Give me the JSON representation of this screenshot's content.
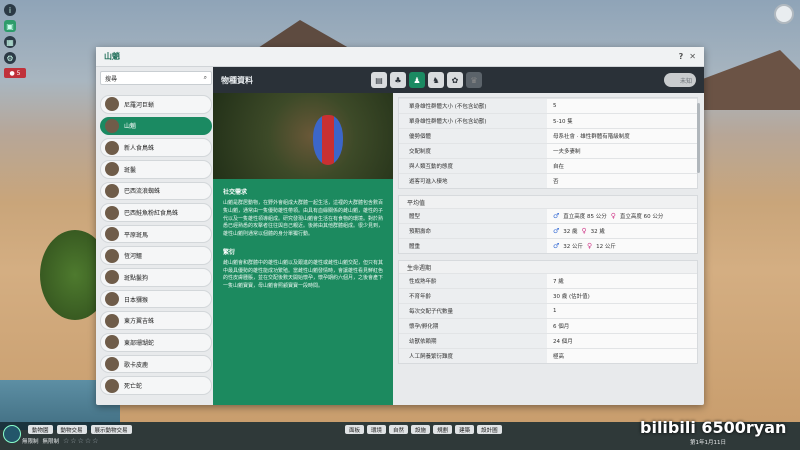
{
  "window": {
    "title": "山魈",
    "help": "?",
    "close": "✕"
  },
  "search": {
    "placeholder": "搜尋"
  },
  "list": [
    "尼羅河巨蜥",
    "山魈",
    "新人食鳥蛛",
    "斑鬣",
    "巴西流浪蜘蛛",
    "巴西鮭魚粉紅食鳥蛛",
    "平原斑馬",
    "恆河鱷",
    "斑點鬣狗",
    "日本獼猴",
    "東方翼吉蛛",
    "東部珊瑚蛇",
    "歌卡皮鹿",
    "死亡蛇"
  ],
  "panel": {
    "title": "物種資料",
    "unknown": "未知"
  },
  "description": {
    "h1": "社交需求",
    "p1": "山魈是群居動物，在野外會組成大群體一起生活，這裡的大群體包含數百隻山魈，通常由一隻優勢雄性帶領。由具有血緣關係的雌山魈，雄性的子代以及一隻雄性領導組成。研究發現山魈會生活在有食物的環境。對於熟悉已經熟悉的攻擊者往往與自己親近。後將由其他群體組成。很少見到，雄性山魈則通常以個體的身分單獨行動。",
    "h2": "繁衍",
    "p2": "雌山魈會和群體中的雄性山魈以及跟進的雄性或雌性山魈交配，但只有其中最具優勢的雄性能成功繁殖。當雌性山魈發情時，會讓雄性看見鮮紅色的性皮膚腫脹，並在交配後數天開始懷孕，懷孕期約六個月，之後會產下一隻山魈寶寶，母山魈會照顧寶寶一段時間。"
  },
  "stats": {
    "group": [
      {
        "k": "單身雄性群體大小 (不包含幼獸)",
        "v": "5"
      },
      {
        "k": "單身雄性群體大小 (不包含幼獸)",
        "v": "5-10 隻"
      },
      {
        "k": "優勢個體",
        "v": "母系社會 · 雄性群體有階級制度"
      },
      {
        "k": "交配制度",
        "v": "一夫多妻制"
      },
      {
        "k": "與人類互動的態度",
        "v": "自在"
      },
      {
        "k": "遊客可進入棲地",
        "v": "否"
      }
    ],
    "avg_title": "平均值",
    "avg": [
      {
        "k": "體型",
        "m": "直立高度 85 公分",
        "f": "直立高度 60 公分"
      },
      {
        "k": "預期壽命",
        "m": "32 歲",
        "f": "32 歲"
      },
      {
        "k": "體重",
        "m": "32 公斤",
        "f": "12 公斤"
      }
    ],
    "life_title": "生命週期",
    "life": [
      {
        "k": "性成熟年齡",
        "v": "7 歲"
      },
      {
        "k": "不育年齡",
        "v": "30 歲 (估計值)"
      },
      {
        "k": "每次交配子代數量",
        "v": "1"
      },
      {
        "k": "懷孕/孵化期",
        "v": "6 個月"
      },
      {
        "k": "幼獸依賴期",
        "v": "24 個月"
      },
      {
        "k": "人工飼養繁衍難度",
        "v": "極高"
      }
    ]
  },
  "bottom": {
    "btn1": "動物園",
    "btn2": "動物交易",
    "btn3": "展示動物交易",
    "mid": [
      "面板",
      "環境",
      "自然",
      "設施",
      "規劃",
      "建築",
      "設計圖"
    ],
    "stat1": "無限制",
    "stat2": "無限制",
    "date": "第1年1月11日",
    "stars": "☆☆☆☆☆"
  },
  "watermark": "bilibili 6500ryan"
}
